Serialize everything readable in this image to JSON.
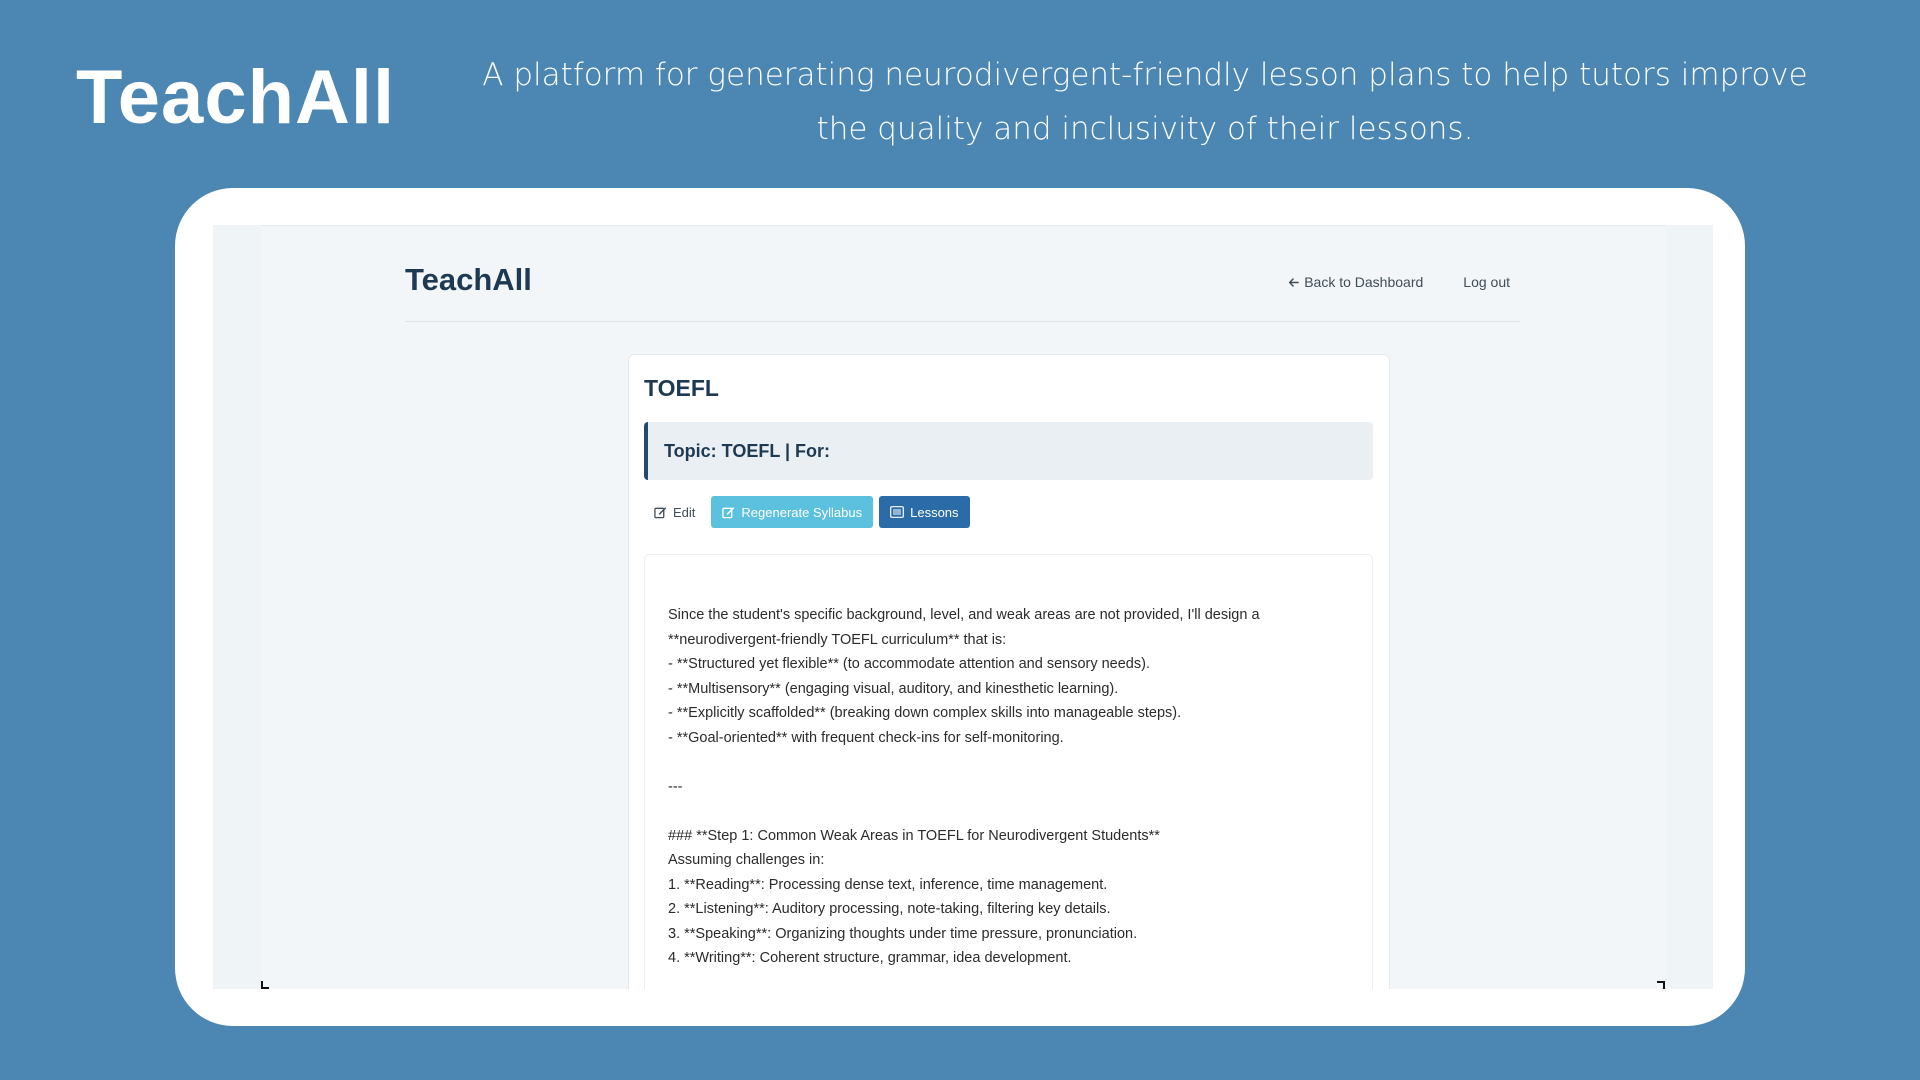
{
  "header": {
    "brand": "TeachAll",
    "tagline": "A platform for generating neurodivergent-friendly lesson plans to help tutors improve the quality and inclusivity of their lessons."
  },
  "app": {
    "logo": "TeachAll",
    "nav": {
      "back_label": "Back to Dashboard",
      "logout_label": "Log out"
    },
    "card": {
      "title": "TOEFL",
      "topic": "Topic: TOEFL | For:",
      "actions": {
        "edit_label": "Edit",
        "regenerate_label": "Regenerate Syllabus",
        "lessons_label": "Lessons"
      },
      "content_lines": [
        "Since the student's specific background, level, and weak areas are not provided, I'll design a",
        "**neurodivergent-friendly TOEFL curriculum** that is:",
        "- **Structured yet flexible** (to accommodate attention and sensory needs).",
        "- **Multisensory** (engaging visual, auditory, and kinesthetic learning).",
        "- **Explicitly scaffolded** (breaking down complex skills into manageable steps).",
        "- **Goal-oriented** with frequent check-ins for self-monitoring.",
        "",
        "---",
        "",
        "### **Step 1: Common Weak Areas in TOEFL for Neurodivergent Students**",
        "Assuming challenges in:",
        "1. **Reading**: Processing dense text, inference, time management.",
        "2. **Listening**: Auditory processing, note-taking, filtering key details.",
        "3. **Speaking**: Organizing thoughts under time pressure, pronunciation.",
        "4. **Writing**: Coherent structure, grammar, idea development."
      ]
    }
  },
  "colors": {
    "background": "#4b87b2",
    "regenerate_button": "#5bc1de",
    "lessons_button": "#2b6ca8",
    "heading": "#1e3a52"
  },
  "icons": {
    "back": "arrow-left-icon",
    "edit": "edit-icon",
    "regenerate": "edit-icon",
    "lessons": "list-icon"
  }
}
